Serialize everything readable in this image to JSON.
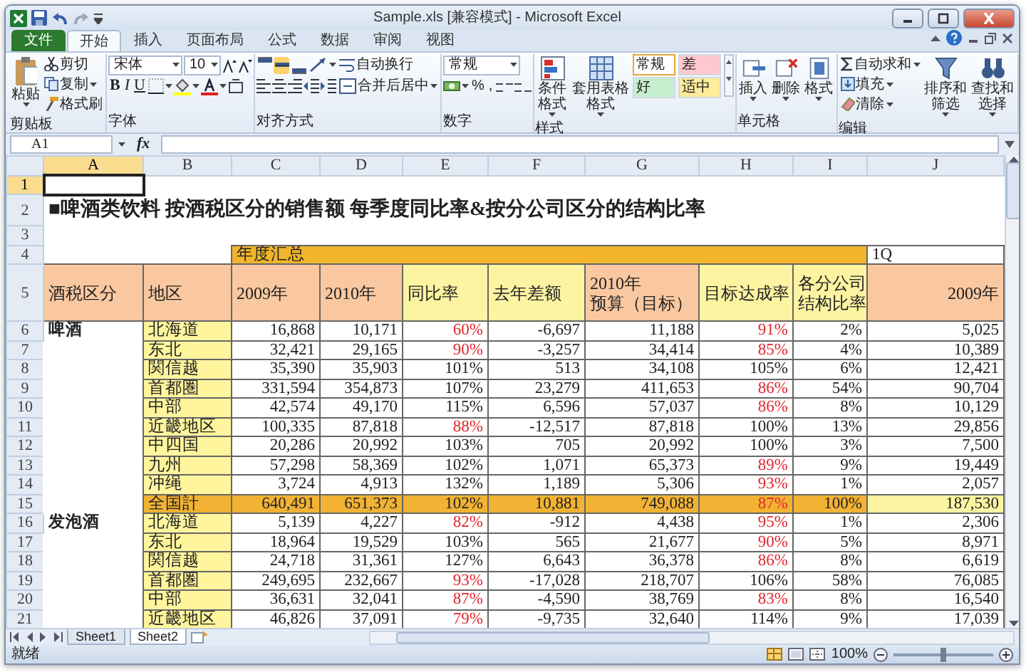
{
  "window": {
    "title": "Sample.xls [兼容模式] - Microsoft Excel"
  },
  "ribbon_tabs": [
    {
      "label": "文件",
      "kind": "file",
      "selected": false
    },
    {
      "label": "开始",
      "kind": "tab",
      "selected": true
    },
    {
      "label": "插入",
      "kind": "tab",
      "selected": false
    },
    {
      "label": "页面布局",
      "kind": "tab",
      "selected": false
    },
    {
      "label": "公式",
      "kind": "tab",
      "selected": false
    },
    {
      "label": "数据",
      "kind": "tab",
      "selected": false
    },
    {
      "label": "审阅",
      "kind": "tab",
      "selected": false
    },
    {
      "label": "视图",
      "kind": "tab",
      "selected": false
    }
  ],
  "ribbon": {
    "clipboard": {
      "paste": "粘贴",
      "cut": "剪切",
      "copy": "复制",
      "format_painter": "格式刷",
      "label": "剪贴板"
    },
    "font": {
      "name": "宋体",
      "size": "10",
      "styles": [
        "B",
        "I",
        "U"
      ],
      "label": "字体"
    },
    "alignment": {
      "vertical": [
        {
          "selected": false
        },
        {
          "selected": true
        },
        {
          "selected": false
        }
      ],
      "wrap": "自动换行",
      "merge": "合并后居中",
      "label": "对齐方式"
    },
    "number": {
      "format": "常规",
      "symbols": [
        "%",
        ","
      ],
      "label": "数字"
    },
    "styles": {
      "conditional": "条件格式",
      "table": "套用表格格式",
      "gallery": [
        {
          "label": "常规",
          "color": "#ffffff",
          "selected": true
        },
        {
          "label": "差",
          "color": "#ffc7ce",
          "selected": false
        },
        {
          "label": "好",
          "color": "#c6efce",
          "selected": false
        },
        {
          "label": "适中",
          "color": "#ffeb9c",
          "selected": false
        }
      ],
      "label": "样式"
    },
    "cells": {
      "buttons": [
        "插入",
        "删除",
        "格式"
      ],
      "label": "单元格"
    },
    "editing": {
      "autosum": "自动求和",
      "fill": "填充",
      "clear": "清除",
      "sort": "排序和筛选",
      "find": "查找和选择",
      "label": "编辑"
    }
  },
  "formula_bar": {
    "name_box": "A1",
    "function": "fx"
  },
  "columns": [
    {
      "label": "A",
      "selected": true
    },
    {
      "label": "B",
      "selected": false
    },
    {
      "label": "C",
      "selected": false
    },
    {
      "label": "D",
      "selected": false
    },
    {
      "label": "E",
      "selected": false
    },
    {
      "label": "F",
      "selected": false
    },
    {
      "label": "G",
      "selected": false
    },
    {
      "label": "H",
      "selected": false
    },
    {
      "label": "I",
      "selected": false
    },
    {
      "label": "J",
      "selected": false
    }
  ],
  "row_numbers": [
    {
      "label": "1",
      "selected": true
    },
    {
      "label": "2",
      "selected": false
    },
    {
      "label": "3",
      "selected": false
    },
    {
      "label": "4",
      "selected": false
    },
    {
      "label": "5",
      "selected": false
    },
    {
      "label": "6",
      "selected": false
    },
    {
      "label": "7",
      "selected": false
    },
    {
      "label": "8",
      "selected": false
    },
    {
      "label": "9",
      "selected": false
    },
    {
      "label": "10",
      "selected": false
    },
    {
      "label": "11",
      "selected": false
    },
    {
      "label": "12",
      "selected": false
    },
    {
      "label": "13",
      "selected": false
    },
    {
      "label": "14",
      "selected": false
    },
    {
      "label": "15",
      "selected": false
    },
    {
      "label": "16",
      "selected": false
    },
    {
      "label": "17",
      "selected": false
    },
    {
      "label": "18",
      "selected": false
    },
    {
      "label": "19",
      "selected": false
    },
    {
      "label": "20",
      "selected": false
    },
    {
      "label": "21",
      "selected": false
    }
  ],
  "sheet": {
    "title": "■啤酒类饮料  按酒税区分的销售额  每季度同比率&按分公司区分的结构比率",
    "band": "年度汇总",
    "quarter": "1Q",
    "header": [
      {
        "lines": [
          "酒税区分"
        ],
        "color": "#fac8a0"
      },
      {
        "lines": [
          "地区"
        ],
        "color": "#fac8a0"
      },
      {
        "lines": [
          "2009年"
        ],
        "color": "#fac8a0"
      },
      {
        "lines": [
          "2010年"
        ],
        "color": "#fac8a0"
      },
      {
        "lines": [
          "同比率"
        ],
        "color": "#fdf4a2"
      },
      {
        "lines": [
          "去年差额"
        ],
        "color": "#fdf4a2"
      },
      {
        "lines": [
          "2010年",
          "预算（目标）"
        ],
        "color": "#fac8a0"
      },
      {
        "lines": [
          "目标达成率"
        ],
        "color": "#fdf4a2"
      },
      {
        "lines": [
          "各分公司",
          "结构比率"
        ],
        "color": "#fdf4a2"
      },
      {
        "lines": [
          "2009年"
        ],
        "color": "#fac8a0"
      }
    ],
    "groups": [
      {
        "category": "啤酒",
        "rows": [
          {
            "region": "北海道",
            "total": false,
            "v2009": "16,868",
            "v2010": "10,171",
            "yoy": "60%",
            "yoy_alert": true,
            "diff": "-6,697",
            "budget": "11,188",
            "achieve": "91%",
            "achieve_alert": true,
            "share": "2%",
            "q1_2009": "5,025"
          },
          {
            "region": "东北",
            "total": false,
            "v2009": "32,421",
            "v2010": "29,165",
            "yoy": "90%",
            "yoy_alert": true,
            "diff": "-3,257",
            "budget": "34,414",
            "achieve": "85%",
            "achieve_alert": true,
            "share": "4%",
            "q1_2009": "10,389"
          },
          {
            "region": "関信越",
            "total": false,
            "v2009": "35,390",
            "v2010": "35,903",
            "yoy": "101%",
            "yoy_alert": false,
            "diff": "513",
            "budget": "34,108",
            "achieve": "105%",
            "achieve_alert": false,
            "share": "6%",
            "q1_2009": "12,421"
          },
          {
            "region": "首都圏",
            "total": false,
            "v2009": "331,594",
            "v2010": "354,873",
            "yoy": "107%",
            "yoy_alert": false,
            "diff": "23,279",
            "budget": "411,653",
            "achieve": "86%",
            "achieve_alert": true,
            "share": "54%",
            "q1_2009": "90,704"
          },
          {
            "region": "中部",
            "total": false,
            "v2009": "42,574",
            "v2010": "49,170",
            "yoy": "115%",
            "yoy_alert": false,
            "diff": "6,596",
            "budget": "57,037",
            "achieve": "86%",
            "achieve_alert": true,
            "share": "8%",
            "q1_2009": "10,129"
          },
          {
            "region": "近畿地区",
            "total": false,
            "v2009": "100,335",
            "v2010": "87,818",
            "yoy": "88%",
            "yoy_alert": true,
            "diff": "-12,517",
            "budget": "87,818",
            "achieve": "100%",
            "achieve_alert": false,
            "share": "13%",
            "q1_2009": "29,856"
          },
          {
            "region": "中四国",
            "total": false,
            "v2009": "20,286",
            "v2010": "20,992",
            "yoy": "103%",
            "yoy_alert": false,
            "diff": "705",
            "budget": "20,992",
            "achieve": "100%",
            "achieve_alert": false,
            "share": "3%",
            "q1_2009": "7,500"
          },
          {
            "region": "九州",
            "total": false,
            "v2009": "57,298",
            "v2010": "58,369",
            "yoy": "102%",
            "yoy_alert": false,
            "diff": "1,071",
            "budget": "65,373",
            "achieve": "89%",
            "achieve_alert": true,
            "share": "9%",
            "q1_2009": "19,449"
          },
          {
            "region": "冲绳",
            "total": false,
            "v2009": "3,724",
            "v2010": "4,913",
            "yoy": "132%",
            "yoy_alert": false,
            "diff": "1,189",
            "budget": "5,306",
            "achieve": "93%",
            "achieve_alert": true,
            "share": "1%",
            "q1_2009": "2,057"
          },
          {
            "region": "全国計",
            "total": true,
            "v2009": "640,491",
            "v2010": "651,373",
            "yoy": "102%",
            "yoy_alert": false,
            "diff": "10,881",
            "budget": "749,088",
            "achieve": "87%",
            "achieve_alert": true,
            "share": "100%",
            "q1_2009": "187,530"
          }
        ]
      },
      {
        "category": "发泡酒",
        "rows": [
          {
            "region": "北海道",
            "total": false,
            "v2009": "5,139",
            "v2010": "4,227",
            "yoy": "82%",
            "yoy_alert": true,
            "diff": "-912",
            "budget": "4,438",
            "achieve": "95%",
            "achieve_alert": true,
            "share": "1%",
            "q1_2009": "2,306"
          },
          {
            "region": "东北",
            "total": false,
            "v2009": "18,964",
            "v2010": "19,529",
            "yoy": "103%",
            "yoy_alert": false,
            "diff": "565",
            "budget": "21,677",
            "achieve": "90%",
            "achieve_alert": true,
            "share": "5%",
            "q1_2009": "8,971"
          },
          {
            "region": "関信越",
            "total": false,
            "v2009": "24,718",
            "v2010": "31,361",
            "yoy": "127%",
            "yoy_alert": false,
            "diff": "6,643",
            "budget": "36,378",
            "achieve": "86%",
            "achieve_alert": true,
            "share": "8%",
            "q1_2009": "6,619"
          },
          {
            "region": "首都圏",
            "total": false,
            "v2009": "249,695",
            "v2010": "232,667",
            "yoy": "93%",
            "yoy_alert": true,
            "diff": "-17,028",
            "budget": "218,707",
            "achieve": "106%",
            "achieve_alert": false,
            "share": "58%",
            "q1_2009": "76,085"
          },
          {
            "region": "中部",
            "total": false,
            "v2009": "36,631",
            "v2010": "32,041",
            "yoy": "87%",
            "yoy_alert": true,
            "diff": "-4,590",
            "budget": "38,769",
            "achieve": "83%",
            "achieve_alert": true,
            "share": "8%",
            "q1_2009": "16,540"
          },
          {
            "region": "近畿地区",
            "total": false,
            "v2009": "46,826",
            "v2010": "37,091",
            "yoy": "79%",
            "yoy_alert": true,
            "diff": "-9,735",
            "budget": "32,640",
            "achieve": "114%",
            "achieve_alert": false,
            "share": "9%",
            "q1_2009": "17,039"
          }
        ]
      }
    ]
  },
  "sheet_tabs": [
    {
      "label": "Sheet1",
      "selected": false
    },
    {
      "label": "Sheet2",
      "selected": true
    }
  ],
  "status_bar": {
    "text": "就绪",
    "zoom": "100%",
    "zoom_slider": {
      "level": 0.5
    }
  }
}
